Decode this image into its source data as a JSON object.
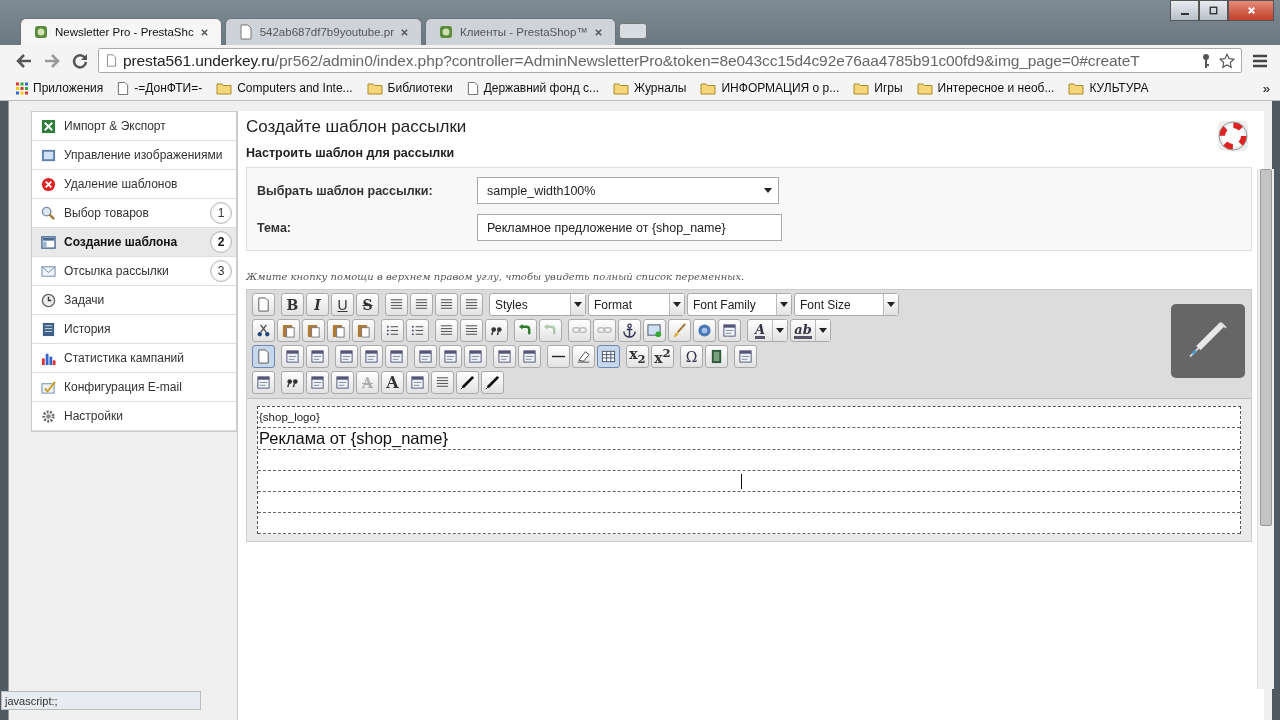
{
  "browser": {
    "tabs": [
      {
        "title": "Newsletter Pro - PrestaShc",
        "selected": true
      },
      {
        "title": "542ab687df7b9youtube.pr",
        "selected": false
      },
      {
        "title": "Клиенты - PrestaShop™",
        "selected": false
      }
    ],
    "address": {
      "host": "presta561.underkey.ru",
      "path": "/pr562/admin0/index.php?controller=AdminNewsletterPro&token=8e043cc15d4c92e76aa4785b91c00fd9&img_page=0#createT"
    },
    "bookmarks": [
      {
        "label": "Приложения",
        "kind": "apps"
      },
      {
        "label": "-=ДонФТИ=-",
        "kind": "page"
      },
      {
        "label": "Computers and Inte...",
        "kind": "folder"
      },
      {
        "label": "Библиотеки",
        "kind": "folder"
      },
      {
        "label": "Державний фонд с...",
        "kind": "page"
      },
      {
        "label": "Журналы",
        "kind": "folder"
      },
      {
        "label": "ИНФОРМАЦИЯ о р...",
        "kind": "folder"
      },
      {
        "label": "Игры",
        "kind": "folder"
      },
      {
        "label": "Интересное и необ...",
        "kind": "folder"
      },
      {
        "label": "КУЛЬТУРА",
        "kind": "folder"
      }
    ],
    "bookmarks_more": "»"
  },
  "sidebar": {
    "items": [
      {
        "label": "Импорт & Экспорт",
        "selected": false
      },
      {
        "label": "Управление изображениями",
        "selected": false
      },
      {
        "label": "Удаление шаблонов",
        "selected": false
      },
      {
        "label": "Выбор товаров",
        "badge": "1",
        "selected": false
      },
      {
        "label": "Создание шаблона",
        "badge": "2",
        "selected": true
      },
      {
        "label": "Отсылка рассылки",
        "badge": "3",
        "selected": false
      },
      {
        "label": "Задачи",
        "selected": false
      },
      {
        "label": "История",
        "selected": false
      },
      {
        "label": "Статистика кампаний",
        "selected": false
      },
      {
        "label": "Конфигурация E-mail",
        "selected": false
      },
      {
        "label": "Настройки",
        "selected": false
      }
    ]
  },
  "main": {
    "title": "Создайте шаблон рассылки",
    "subtitle": "Настроить шаблон для рассылки",
    "fields": [
      {
        "label": "Выбрать шаблон рассылки:",
        "kind": "select",
        "value": "sample_width100%"
      },
      {
        "label": "Тема:",
        "kind": "text",
        "value": "Рекламное предложение от {shop_name}"
      }
    ],
    "hint": "Жмите кнопку помощи в верхнем правом углу, чтобы увидеть полный список переменных.",
    "toolbar": [
      [
        [
          {
            "kind": "page"
          }
        ],
        [
          {
            "kind": "bold",
            "glyph": "B"
          },
          {
            "kind": "italic",
            "glyph": "I"
          },
          {
            "kind": "underline",
            "glyph": "U"
          },
          {
            "kind": "strike",
            "glyph": "S"
          }
        ],
        [
          {
            "kind": "lines"
          },
          {
            "kind": "lines"
          },
          {
            "kind": "lines"
          },
          {
            "kind": "lines"
          }
        ],
        [
          {
            "kind": "dropdown",
            "label": "Styles"
          },
          {
            "kind": "dropdown",
            "label": "Format"
          },
          {
            "kind": "dropdown",
            "label": "Font Family"
          },
          {
            "kind": "dropdown",
            "label": "Font Size"
          }
        ]
      ],
      [
        [
          {
            "kind": "scissors"
          },
          {
            "kind": "clipboard"
          },
          {
            "kind": "clipboard"
          },
          {
            "kind": "clipboard"
          },
          {
            "kind": "clipboard"
          }
        ],
        [
          {
            "kind": "list"
          },
          {
            "kind": "list"
          }
        ],
        [
          {
            "kind": "lines"
          },
          {
            "kind": "lines"
          },
          {
            "kind": "quote"
          }
        ],
        [
          {
            "kind": "arrow"
          },
          {
            "kind": "arrow",
            "disabled": true
          }
        ],
        [
          {
            "kind": "link",
            "disabled": true
          },
          {
            "kind": "link",
            "disabled": true
          },
          {
            "kind": "anchor"
          },
          {
            "kind": "image"
          },
          {
            "kind": "brush"
          },
          {
            "kind": "globe"
          },
          {
            "kind": "window"
          }
        ],
        [
          {
            "kind": "split",
            "glyph": "A"
          },
          {
            "kind": "split",
            "glyph": "ab"
          }
        ]
      ],
      [
        [
          {
            "kind": "page",
            "active": true
          }
        ],
        [
          {
            "kind": "window"
          },
          {
            "kind": "window"
          }
        ],
        [
          {
            "kind": "window"
          },
          {
            "kind": "window"
          },
          {
            "kind": "window"
          }
        ],
        [
          {
            "kind": "window"
          },
          {
            "kind": "window"
          },
          {
            "kind": "window"
          }
        ],
        [
          {
            "kind": "window"
          },
          {
            "kind": "window"
          }
        ],
        [
          {
            "kind": "rule"
          },
          {
            "kind": "eraser"
          },
          {
            "kind": "table",
            "active": true
          }
        ],
        [
          {
            "kind": "bold",
            "glyph": "x$_{2}$"
          },
          {
            "kind": "bold",
            "glyph": "x$^{2}$"
          }
        ],
        [
          {
            "kind": "symbol",
            "glyph": "Ω"
          },
          {
            "kind": "film"
          }
        ],
        [
          {
            "kind": "window"
          }
        ]
      ],
      [
        [
          {
            "kind": "window"
          }
        ],
        [
          {
            "kind": "quote"
          },
          {
            "kind": "window"
          },
          {
            "kind": "window"
          },
          {
            "kind": "strike",
            "glyph": "A",
            "disabled": true
          },
          {
            "kind": "serif",
            "glyph": "A"
          },
          {
            "kind": "window"
          },
          {
            "kind": "lines"
          },
          {
            "kind": "pen"
          },
          {
            "kind": "pen"
          }
        ]
      ]
    ],
    "content": [
      {
        "kind": "small",
        "text": "{shop_logo}",
        "caret": false
      },
      {
        "kind": "heading",
        "text": "Реклама от {shop_name}",
        "caret": false
      },
      {
        "kind": "empty",
        "caret": false
      },
      {
        "kind": "empty",
        "caret": true
      },
      {
        "kind": "empty",
        "caret": false
      },
      {
        "kind": "empty",
        "caret": false
      }
    ]
  },
  "status": "javascript:;"
}
